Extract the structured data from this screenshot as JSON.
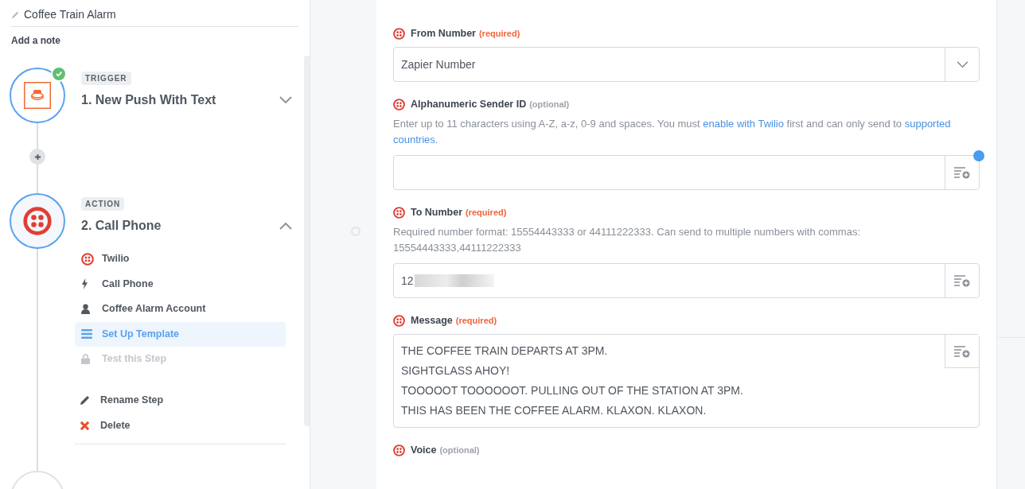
{
  "zap_title": "Coffee Train Alarm",
  "add_note": "Add a note",
  "steps": [
    {
      "kind": "trigger",
      "badge": "TRIGGER",
      "title": "1. New Push With Text",
      "complete": true,
      "expanded": false,
      "selected": true
    },
    {
      "kind": "action",
      "badge": "ACTION",
      "title": "2. Call Phone",
      "complete": false,
      "expanded": true,
      "selected": true,
      "menu": [
        {
          "label": "Twilio",
          "selected": false,
          "disabled": false
        },
        {
          "label": "Call Phone",
          "selected": false,
          "disabled": false
        },
        {
          "label": "Coffee Alarm Account",
          "selected": false,
          "disabled": false
        },
        {
          "label": "Set Up Template",
          "selected": true,
          "disabled": false
        },
        {
          "label": "Test this Step",
          "selected": false,
          "disabled": true
        }
      ],
      "actions": [
        {
          "label": "Rename Step"
        },
        {
          "label": "Delete"
        }
      ]
    }
  ],
  "fields": [
    {
      "kind": "select",
      "label": "From Number",
      "tag": "(required)",
      "required": true,
      "value": "Zapier Number"
    },
    {
      "kind": "text",
      "label": "Alphanumeric Sender ID",
      "tag": "(optional)",
      "required": false,
      "focused": true,
      "help": [
        {
          "text": "Enter up to 11 characters using A-Z, a-z, 0-9 and spaces. You must ",
          "link": false
        },
        {
          "text": "enable with Twilio",
          "link": true
        },
        {
          "text": " first and can only send to ",
          "link": false
        },
        {
          "text": "supported",
          "link": true
        },
        {
          "text": "countries",
          "link": true
        },
        {
          "text": ".",
          "link": false
        }
      ]
    },
    {
      "kind": "text",
      "label": "To Number",
      "tag": "(required)",
      "required": true,
      "redacted": true,
      "help": [
        {
          "text": "Required number format: 15554443333 or 44111222333. Can send to multiple numbers with commas: 15554443333,44111222333",
          "link": false
        }
      ],
      "value": "12"
    },
    {
      "kind": "textarea",
      "label": "Message",
      "tag": "(required)",
      "required": true,
      "lines": [
        "THE COFFEE TRAIN DEPARTS AT 3PM.",
        "SIGHTGLASS AHOY!",
        "TOOOOOT TOOOOOOT. PULLING OUT OF THE STATION AT 3PM.",
        "THIS HAS BEEN THE COFFEE ALARM. KLAXON. KLAXON."
      ]
    },
    {
      "kind": "label",
      "label": "Voice",
      "tag": "(optional)",
      "required": false
    }
  ]
}
